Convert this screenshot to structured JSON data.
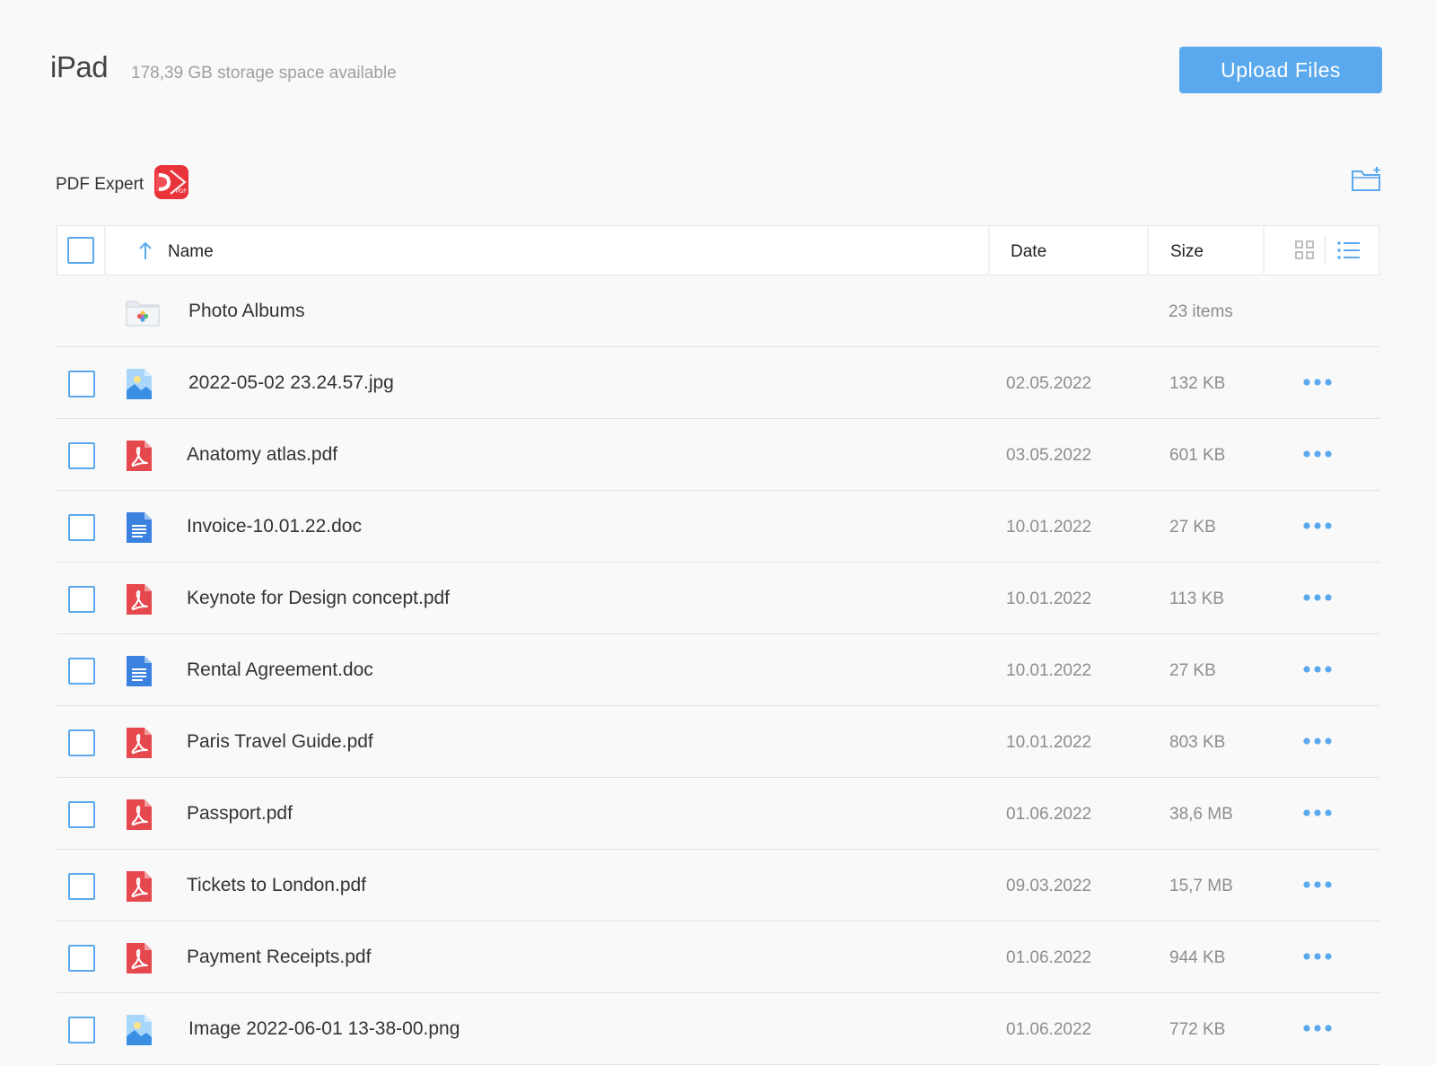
{
  "header": {
    "device_name": "iPad",
    "storage_text": "178,39 GB storage space available",
    "upload_label": "Upload Files"
  },
  "app": {
    "name": "PDF Expert",
    "icon_text": "PDF"
  },
  "table": {
    "columns": {
      "name": "Name",
      "date": "Date",
      "size": "Size"
    },
    "folder": {
      "name": "Photo Albums",
      "count": "23 items"
    },
    "rows": [
      {
        "name": "2022-05-02 23.24.57.jpg",
        "date": "02.05.2022",
        "size": "132 KB",
        "type": "image"
      },
      {
        "name": "Anatomy atlas.pdf",
        "date": "03.05.2022",
        "size": "601 KB",
        "type": "pdf"
      },
      {
        "name": "Invoice-10.01.22.doc",
        "date": "10.01.2022",
        "size": "27 KB",
        "type": "doc"
      },
      {
        "name": "Keynote for Design concept.pdf",
        "date": "10.01.2022",
        "size": "113 KB",
        "type": "pdf"
      },
      {
        "name": "Rental Agreement.doc",
        "date": "10.01.2022",
        "size": "27 KB",
        "type": "doc"
      },
      {
        "name": "Paris Travel Guide.pdf",
        "date": "10.01.2022",
        "size": "803 KB",
        "type": "pdf"
      },
      {
        "name": "Passport.pdf",
        "date": "01.06.2022",
        "size": "38,6 MB",
        "type": "pdf"
      },
      {
        "name": "Tickets to London.pdf",
        "date": "09.03.2022",
        "size": "15,7 MB",
        "type": "pdf"
      },
      {
        "name": "Payment Receipts.pdf",
        "date": "01.06.2022",
        "size": "944 KB",
        "type": "pdf"
      },
      {
        "name": "Image 2022-06-01 13-38-00.png",
        "date": "01.06.2022",
        "size": "772 KB",
        "type": "image"
      }
    ]
  },
  "colors": {
    "accent": "#5aa9ee",
    "pdf": "#e5484d",
    "doc": "#3b82e0"
  }
}
